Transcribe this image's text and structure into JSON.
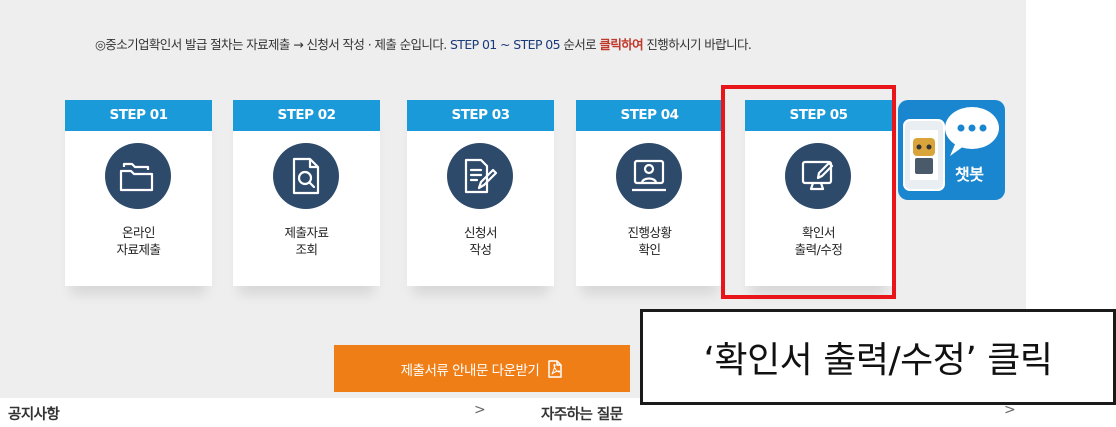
{
  "intro": {
    "part1": "◎중소기업확인서 발급 절차는 자료제출 → 신청서 작성 · 제출 순입니다. ",
    "part2": "STEP 01 ~ STEP 05",
    "part3": " 순서로 ",
    "part4": "클릭하여",
    "part5": " 진행하시기 바랍니다."
  },
  "steps": [
    {
      "head": "STEP 01",
      "line1": "온라인",
      "line2": "자료제출",
      "icon": "folder-icon"
    },
    {
      "head": "STEP 02",
      "line1": "제출자료",
      "line2": "조회",
      "icon": "document-search-icon"
    },
    {
      "head": "STEP 03",
      "line1": "신청서",
      "line2": "작성",
      "icon": "document-edit-icon"
    },
    {
      "head": "STEP 04",
      "line1": "진행상황",
      "line2": "확인",
      "icon": "monitor-user-icon"
    },
    {
      "head": "STEP 05",
      "line1": "확인서",
      "line2": "출력/수정",
      "icon": "monitor-edit-icon"
    }
  ],
  "chatbot": {
    "label": "챗봇",
    "icon": "chatbot-icon"
  },
  "download_button": {
    "label": "제출서류 안내문 다운받기",
    "icon": "pdf-icon"
  },
  "bottom_links": {
    "notice": "공지사항",
    "faq": "자주하는 질문",
    "chevron": ">"
  },
  "callout": {
    "text": "‘확인서 출력/수정’ 클릭"
  },
  "colors": {
    "step_header": "#1a9ad9",
    "icon_circle": "#2e4a6b",
    "highlight": "#e8161b",
    "download": "#f07e16",
    "chatbot": "#1a86d0"
  }
}
